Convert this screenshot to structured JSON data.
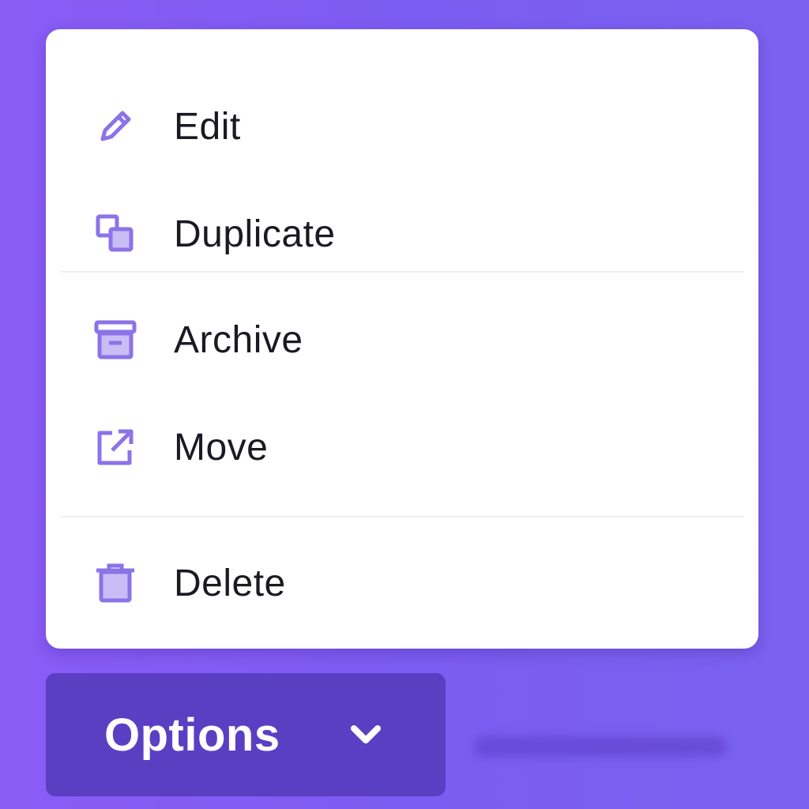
{
  "menu": {
    "items": [
      {
        "label": "Edit",
        "icon": "pencil-icon"
      },
      {
        "label": "Duplicate",
        "icon": "duplicate-icon"
      },
      {
        "label": "Archive",
        "icon": "archive-icon"
      },
      {
        "label": "Move",
        "icon": "external-link-icon"
      },
      {
        "label": "Delete",
        "icon": "trash-icon"
      }
    ]
  },
  "button": {
    "label": "Options",
    "icon": "chevron-down-icon"
  },
  "colors": {
    "background": "#7c5cf2",
    "menu_bg": "#ffffff",
    "icon": "#8b73e8",
    "button_bg": "#5b3fc3",
    "text": "#1b1a22"
  }
}
